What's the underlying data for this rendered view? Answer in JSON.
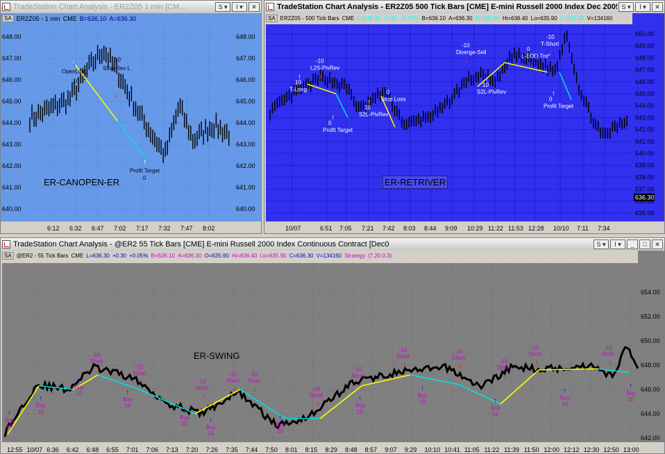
{
  "win1": {
    "title": "TradeStation Chart Analysis - ER2Z05  1 min  [CM...",
    "status": {
      "sa": "SA",
      "symbol": "ER2Z05 - 1 min",
      "exch": "CME",
      "l": "",
      "b": "B=636.10",
      "a": "A=636.30"
    },
    "study_label": "ER-CANOPEN-ER",
    "price_ticks": [
      "648.00",
      "647.00",
      "646.00",
      "645.00",
      "644.00",
      "643.00",
      "642.00",
      "641.00",
      "640.00"
    ],
    "time_ticks": [
      "6:12",
      "6:32",
      "6:47",
      "7:02",
      "7:17",
      "7:32",
      "7:47",
      "8:02"
    ],
    "annotations": {
      "openlong": "OpenLong",
      "openlong_qty": "10",
      "stoprev": "Stop-Rev L",
      "stoprev_qty": "10",
      "profit": "Profit Target",
      "profit_qty": "0"
    },
    "colors": {
      "bg": "#6699e8",
      "price": "#000000",
      "entry_line": "#ffff00",
      "exit_line": "#00e0e0"
    }
  },
  "win2": {
    "title": "TradeStation Chart Analysis - ER2Z05  500 Tick Bars [CME] E-mini Russell 2000 Index Dec 2005",
    "status": {
      "sa": "SA",
      "symbol": "ER2Z05 - 500 Tick Bars",
      "exch": "CME",
      "l": "L=636.30",
      "chg": "+0.30",
      "pct": "+0.05%",
      "b": "B=636.10",
      "a": "A=636.30",
      "o": "O=635.90",
      "hi": "Hi=636.40",
      "lo": "Lo=635.90",
      "c": "C=636.30",
      "v": "V=134160"
    },
    "study_label": "ER-RETRIVER",
    "last_price": "636.30",
    "price_ticks": [
      "650.00",
      "649.00",
      "648.00",
      "647.00",
      "646.00",
      "645.00",
      "644.00",
      "643.00",
      "642.00",
      "641.00",
      "640.00",
      "639.00",
      "638.00",
      "637.00",
      "636.00",
      "635.00"
    ],
    "time_ticks": [
      "10/07",
      "6:51",
      "7:05",
      "7:21",
      "7:42",
      "8:03",
      "8:44",
      "9:09",
      "10:29",
      "11:22",
      "11:53",
      "12:28",
      "10/10",
      "7:11",
      "7:34"
    ],
    "annotations": [
      {
        "label": "T-Long",
        "qty": "10"
      },
      {
        "label": "L2S-PivRev",
        "qty": "-10"
      },
      {
        "label": "Profit Target",
        "qty": "0"
      },
      {
        "label": "Stop Loss",
        "qty": "0"
      },
      {
        "label": "S2L-PivRev",
        "qty": "10"
      },
      {
        "label": "Diverge-Sell",
        "qty": "-10"
      },
      {
        "label": "S2L-PivRev",
        "qty": "10"
      },
      {
        "label": "L-EOD Tra*",
        "qty": "0"
      },
      {
        "label": "T-Short",
        "qty": "-10"
      },
      {
        "label": "Profit Target",
        "qty": "0"
      }
    ],
    "colors": {
      "bg": "#3030ee",
      "grid": "#0000a0",
      "price": "#000000"
    }
  },
  "win3": {
    "title": "TradeStation Chart Analysis - @ER2  55 Tick Bars [CME] E-mini Russell 2000 Index Continuous Contract [Dec0",
    "status": {
      "sa": "SA",
      "symbol": "@ER2 - 55 Tick Bars",
      "exch": "CME",
      "l": "L=636.30",
      "chg": "+0.30",
      "pct": "+0.05%",
      "b": "B=636.10",
      "a": "A=636.30",
      "o": "O=635.90",
      "hi": "Hi=636.40",
      "lo": "Lo=635.90",
      "c": "C=636.30",
      "v": "V=134160",
      "strat": "Strategy",
      "strat_val": "(7.20 0.3)"
    },
    "study_label": "ER-SWING",
    "price_ticks": [
      "654.00",
      "652.00",
      "650.00",
      "648.00",
      "646.00",
      "644.00",
      "642.00"
    ],
    "time_ticks": [
      "12:55",
      "10/07",
      "6:36",
      "6:42",
      "6:48",
      "6:55",
      "7:01",
      "7:06",
      "7:13",
      "7:20",
      "7:26",
      "7:35",
      "7:44",
      "7:50",
      "8:01",
      "8:15",
      "8:29",
      "8:48",
      "8:57",
      "9:07",
      "9:29",
      "10:10",
      "10:41",
      "11:05",
      "11:22",
      "11:39",
      "11:50",
      "12:00",
      "12:12",
      "12:30",
      "12:50",
      "13:00"
    ],
    "marker_sell": "Short",
    "marker_sell_qty": "-10",
    "marker_buy": "Buy",
    "marker_buy_qty": "10",
    "colors": {
      "bg": "#808080",
      "price": "#000000",
      "up_line": "#ffff00",
      "down_line": "#00e0e0",
      "text": "#cc00cc"
    }
  }
}
